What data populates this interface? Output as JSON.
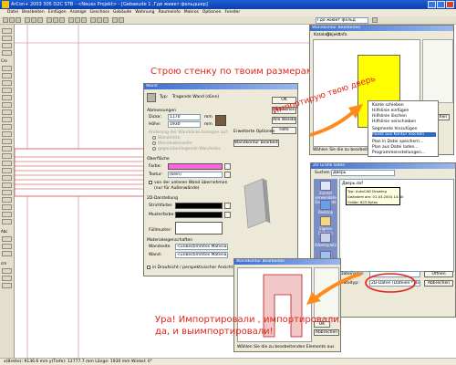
{
  "window": {
    "title": "ArCon+ 2003 305 D2C STB - <Neues Projekt> - [Gebaeude 1 ,Где живет фельдшер]",
    "controls": [
      "minimize-icon",
      "maximize-icon",
      "close-icon"
    ]
  },
  "menu": [
    "Datei",
    "Bearbeiten",
    "Einfügen",
    "Anzeige",
    "Geschoss",
    "Gebäude",
    "Wohnung",
    "Raumeinfo",
    "Makros",
    "Optionen",
    "Fenster"
  ],
  "toolbar": {
    "floor_dropdown": "Где живет фельд"
  },
  "leftbar": {
    "labels": [
      "Cro",
      "Abc",
      "cm"
    ]
  },
  "annotations": {
    "wall": "Строю стенку по твоим размерам",
    "import_door": "Импортирую твою дверь",
    "done_line1": "Ура! Импортировали , импортировали,",
    "done_line2": "да, и выимпортировали!"
  },
  "wand_dialog": {
    "title": "Wand",
    "typ_label": "Typ:",
    "typ_value": "Tragende Wand (dünn)",
    "dimensions_label": "Abmessungen",
    "dicke_label": "Dicke:",
    "dicke_value": "1170",
    "dicke_unit": "mm",
    "hoehe_label": "Höhe:",
    "hoehe_value": "1930",
    "hoehe_unit": "mm",
    "radio_disabled_1": "Anderung der Wanddicke bezogen auf:",
    "radio_1": "Wandmitte",
    "radio_2": "Wandaußenseite",
    "radio_3": "gegenüberliegende Wandseite",
    "oberflaeche_label": "Oberfläche",
    "farbe_label": "Farbe:",
    "farbe_color": "#ff66dd",
    "textur_label": "Textur:",
    "textur_value": "(kein)",
    "checkbox_label": "von der unteren Wand übernehmen",
    "checkbox_sub": "(nur für Außenwände)",
    "darstellung_label": "2D-Darstellung",
    "strichfarbe_label": "Strichfarbe:",
    "musterfarbe_label": "Musterfarbe:",
    "fuellmuster_label": "Füllmuster:",
    "material_label": "Materialeigenschaften",
    "wandseite_label": "Wandseite",
    "wandseite_value": "<unbestimmtes Material",
    "wand_label": "Wand:",
    "wand_value": "<unbestimmtes Material",
    "bottom_check": "in Draufsicht / perspektivischer Ansicht unsichtbar",
    "btn_ok": "OK",
    "btn_cancel": "Abbrechen",
    "btn_apply": "Alle Wände",
    "btn_help": "Hilfe",
    "extended_label": "Erweiterte Optionen",
    "contour_button": "Wandkontur bearbeiten"
  },
  "wandkontur_top": {
    "title": "Wandkontur bearbeiten",
    "tabs": [
      "Katalog",
      "Objekt",
      "Info"
    ],
    "status": "Wählen Sie die zu bearbeitenden Elemente aus",
    "btn_ok": "OK",
    "btn_cancel": "Abbrechen"
  },
  "context_menu": {
    "items": [
      "Kante schieben",
      "Hilfslinie einfügen",
      "Hilfslinie löschen",
      "Hilfslinie verschieben",
      "Segmente hinzufügen",
      "Punkt aus Kontur löschen",
      "Plan in Datei speichern...",
      "Plan aus Datei laden...",
      "Programmeinstellungen..."
    ]
  },
  "file_dialog": {
    "title": "2D Grafik laden",
    "suchen_label": "Suchen in:",
    "folder": "Дверь",
    "files": [
      "Дверь.dxf"
    ],
    "tooltip_line1": "Typ: AutoCAD Drawing",
    "tooltip_line2": "Geändert am: 01.03.2004 14:40",
    "tooltip_line3": "Größe: 623 Bytes",
    "places": [
      "Zuletzt verwendete Dokumente",
      "Desktop",
      "Eigene Dateien",
      "Arbeitsplatz",
      "Netzwerkumgebung"
    ],
    "filename_label": "Dateiname:",
    "filetype_label": "Dateityp:",
    "filetype_value": "2D-Daten (Dateien *.dxf)",
    "btn_open": "Öffnen",
    "btn_cancel": "Abbrechen"
  },
  "wandkontur_bottom": {
    "title": "Wandkontur bearbeiten",
    "status": "Wählen Sie die zu bearbeitenden Elemente aus",
    "btn_ok": "OK",
    "btn_cancel": "Abbrechen"
  },
  "status_bar": {
    "text": "x(Breite): 9136.6 mm  y(Tiefe): 12777.7 mm  Länge: 1930 mm  Winkel: 0°"
  }
}
